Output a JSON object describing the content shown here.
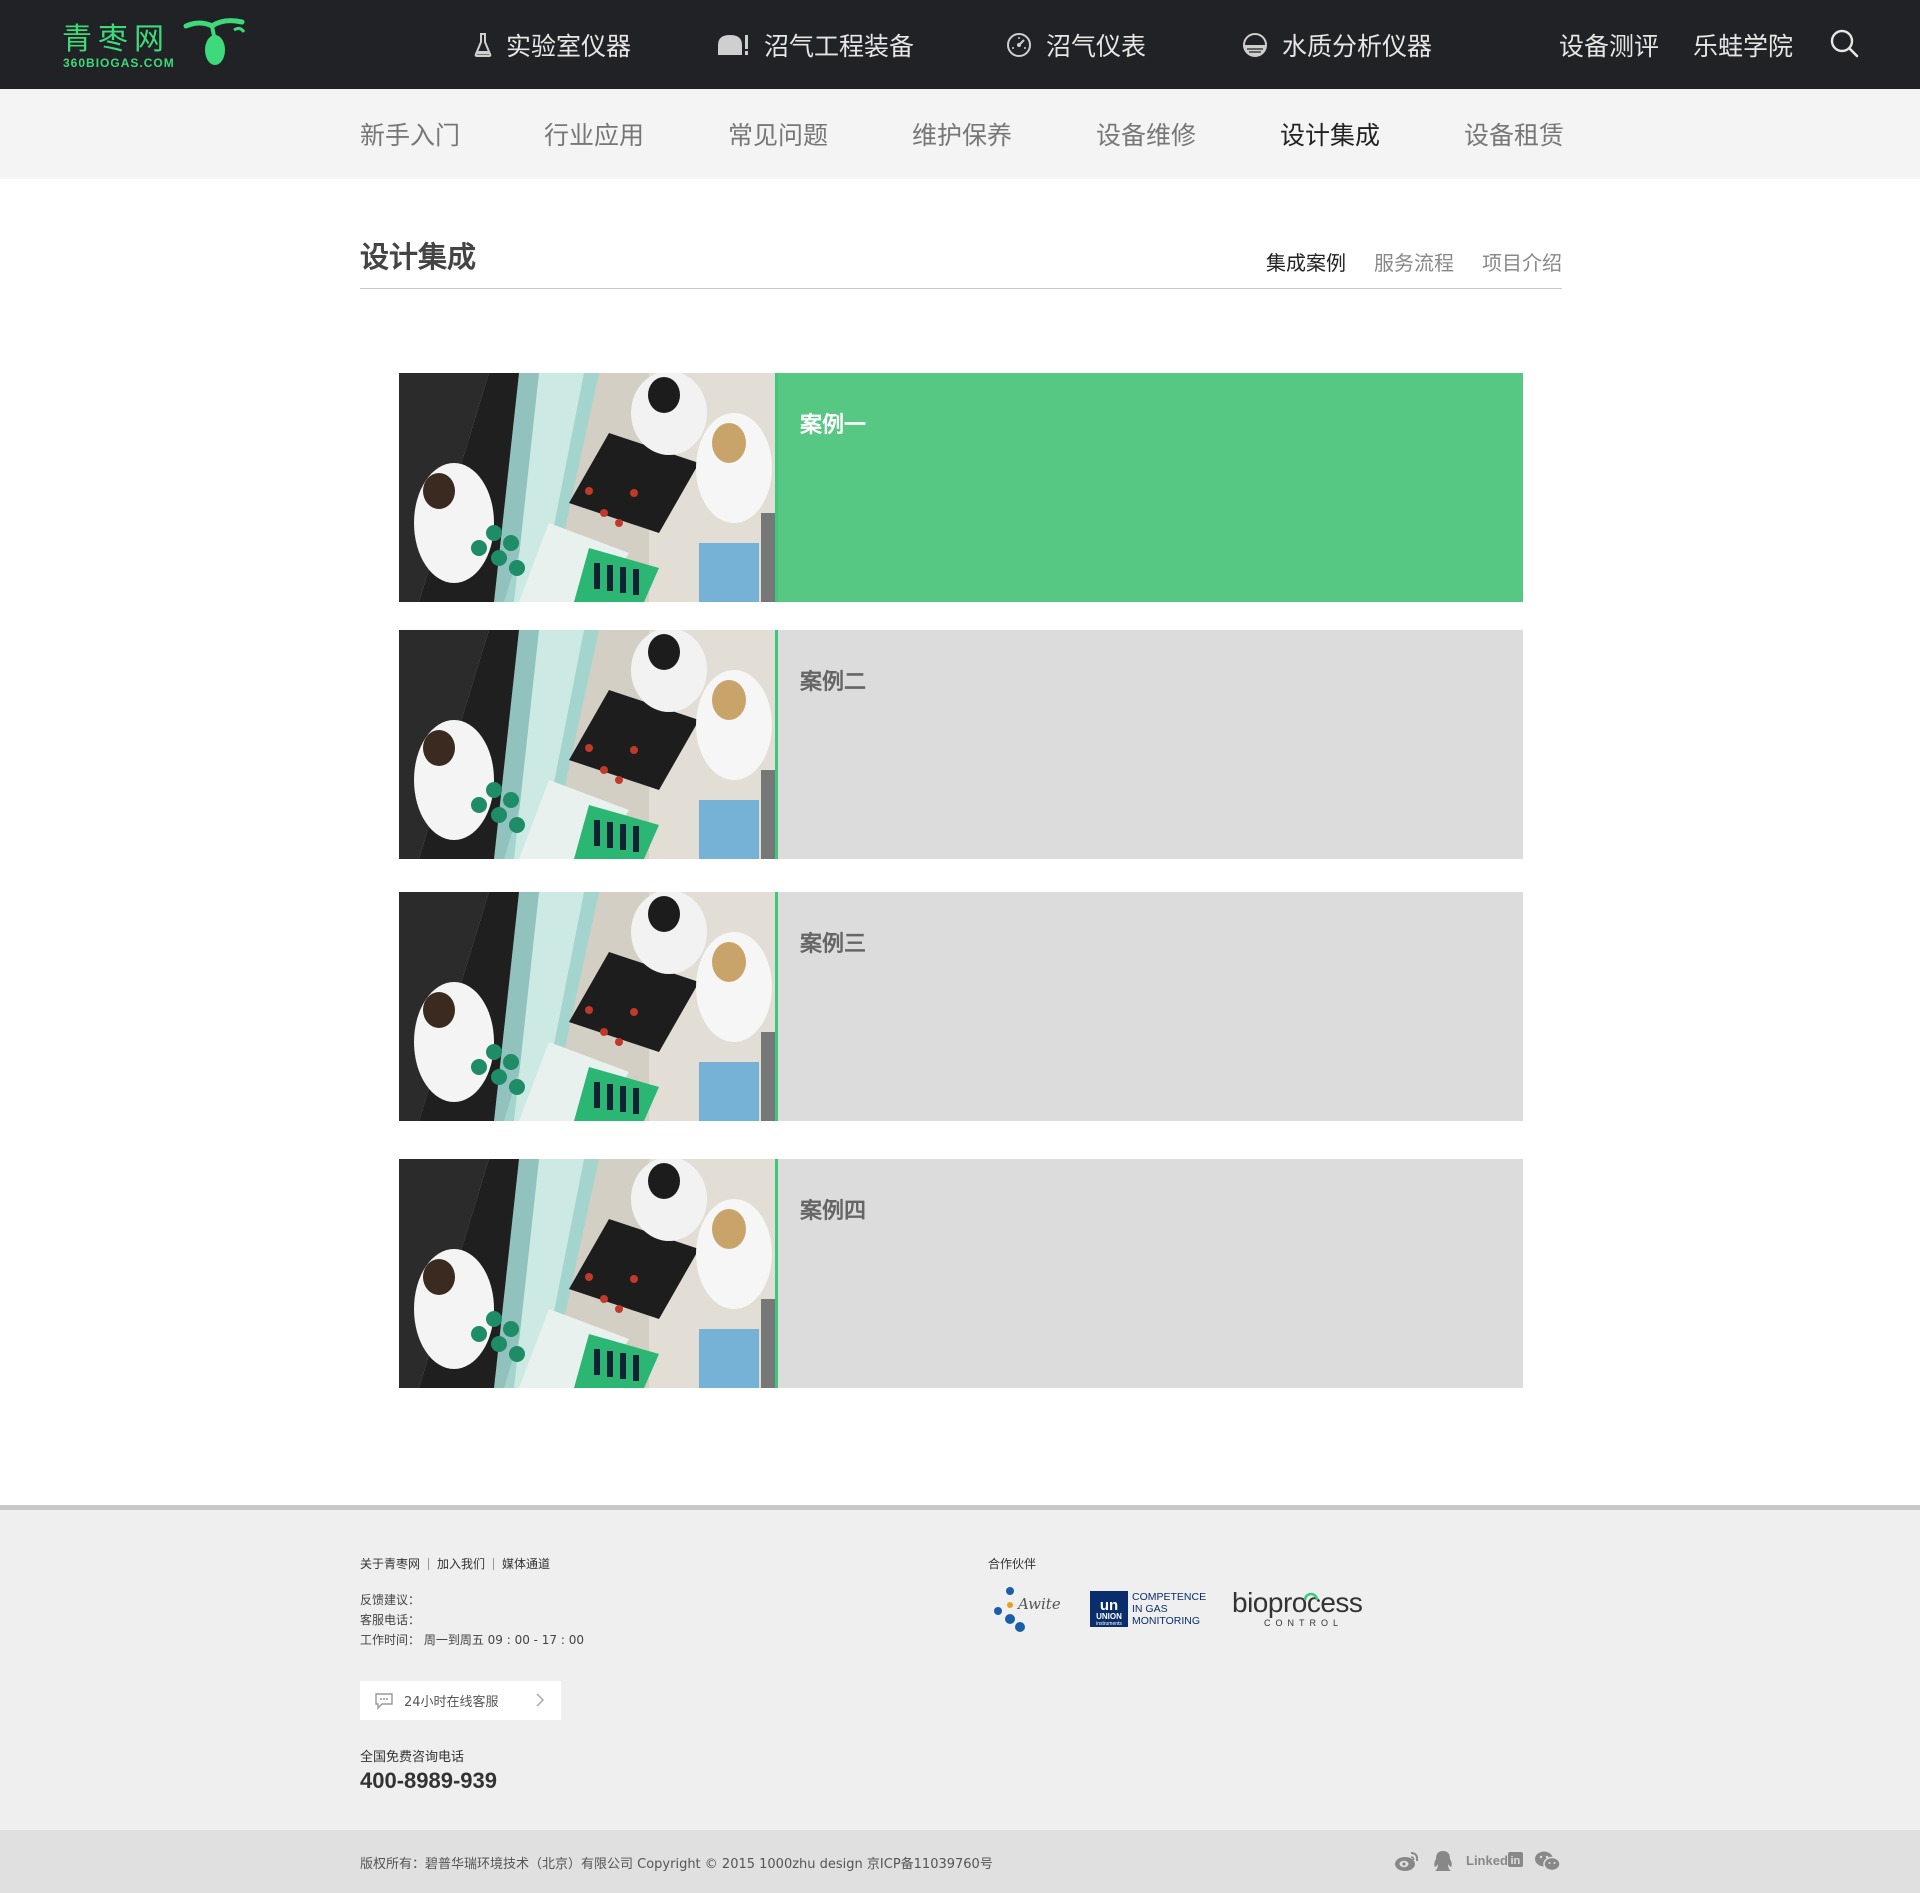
{
  "brand": {
    "logo_cn": "青枣网",
    "logo_en": "360BIOGAS.COM",
    "accent": "#3ed97a"
  },
  "top_nav": {
    "items": [
      {
        "label": "实验室仪器",
        "icon": "flask-icon"
      },
      {
        "label": "沼气工程装备",
        "icon": "tank-icon"
      },
      {
        "label": "沼气仪表",
        "icon": "gauge-icon"
      },
      {
        "label": "水质分析仪器",
        "icon": "water-icon"
      },
      {
        "label": "设备测评"
      },
      {
        "label": "乐蛙学院"
      }
    ],
    "search_icon": "search-icon"
  },
  "sub_nav": {
    "items": [
      "新手入门",
      "行业应用",
      "常见问题",
      "维护保养",
      "设备维修",
      "设计集成",
      "设备租赁"
    ],
    "active_index": 5
  },
  "section": {
    "title": "设计集成",
    "tabs": [
      "集成案例",
      "服务流程",
      "项目介绍"
    ],
    "active_tab": 0
  },
  "cases": [
    {
      "label": "案例一",
      "active": true
    },
    {
      "label": "案例二",
      "active": false
    },
    {
      "label": "案例三",
      "active": false
    },
    {
      "label": "案例四",
      "active": false
    }
  ],
  "colors": {
    "active_panel": "#57c884",
    "inactive_panel": "#dcdcdc",
    "topbar": "#212225"
  },
  "footer": {
    "links": [
      "关于青枣网",
      "加入我们",
      "媒体通道"
    ],
    "feedback": "反馈建议：",
    "service_phone": "客服电话：",
    "hours": "工作时间： 周一到周五 09 : 00 - 17 : 00",
    "chat_button": "24小时在线客服",
    "hotline_label": "全国免费咨询电话",
    "hotline": "400-8989-939",
    "partners_title": "合作伙伴",
    "partners": [
      {
        "name": "Awite"
      },
      {
        "name_top": "COMPETENCE",
        "name_mid": "IN GAS",
        "name_bot": "MONITORING",
        "mark": "UNION",
        "mark_sub": "instruments"
      },
      {
        "name": "bioprocess",
        "sub": "CONTROL"
      }
    ],
    "copyright": "版权所有：碧普华瑞环境技术（北京）有限公司    Copyright © 2015 1000zhu design 京ICP备11039760号",
    "social": [
      "weibo-icon",
      "qq-icon",
      "linkedin-icon",
      "wechat-icon"
    ],
    "linkedin_text": "Linked"
  }
}
